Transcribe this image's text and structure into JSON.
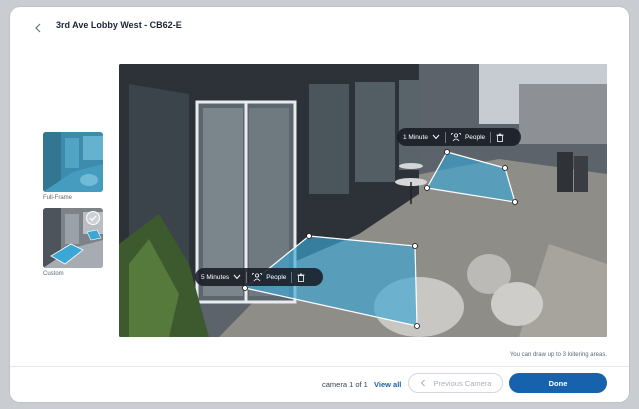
{
  "header": {
    "title": "3rd Ave Lobby West - CB62-E"
  },
  "thumbnails": [
    {
      "label": "Full-Frame"
    },
    {
      "label": "Custom",
      "selected": true
    }
  ],
  "areas": [
    {
      "duration": "1 Minute",
      "target": "People"
    },
    {
      "duration": "5 Minutes",
      "target": "People"
    }
  ],
  "hint": "You can draw up to 3 loitering areas.",
  "footer": {
    "counter": "camera 1 of 1",
    "view_all": "View all",
    "previous": "Previous Camera",
    "done": "Done"
  },
  "colors": {
    "accent": "#1762ad",
    "zone": "#3aa7d6"
  }
}
